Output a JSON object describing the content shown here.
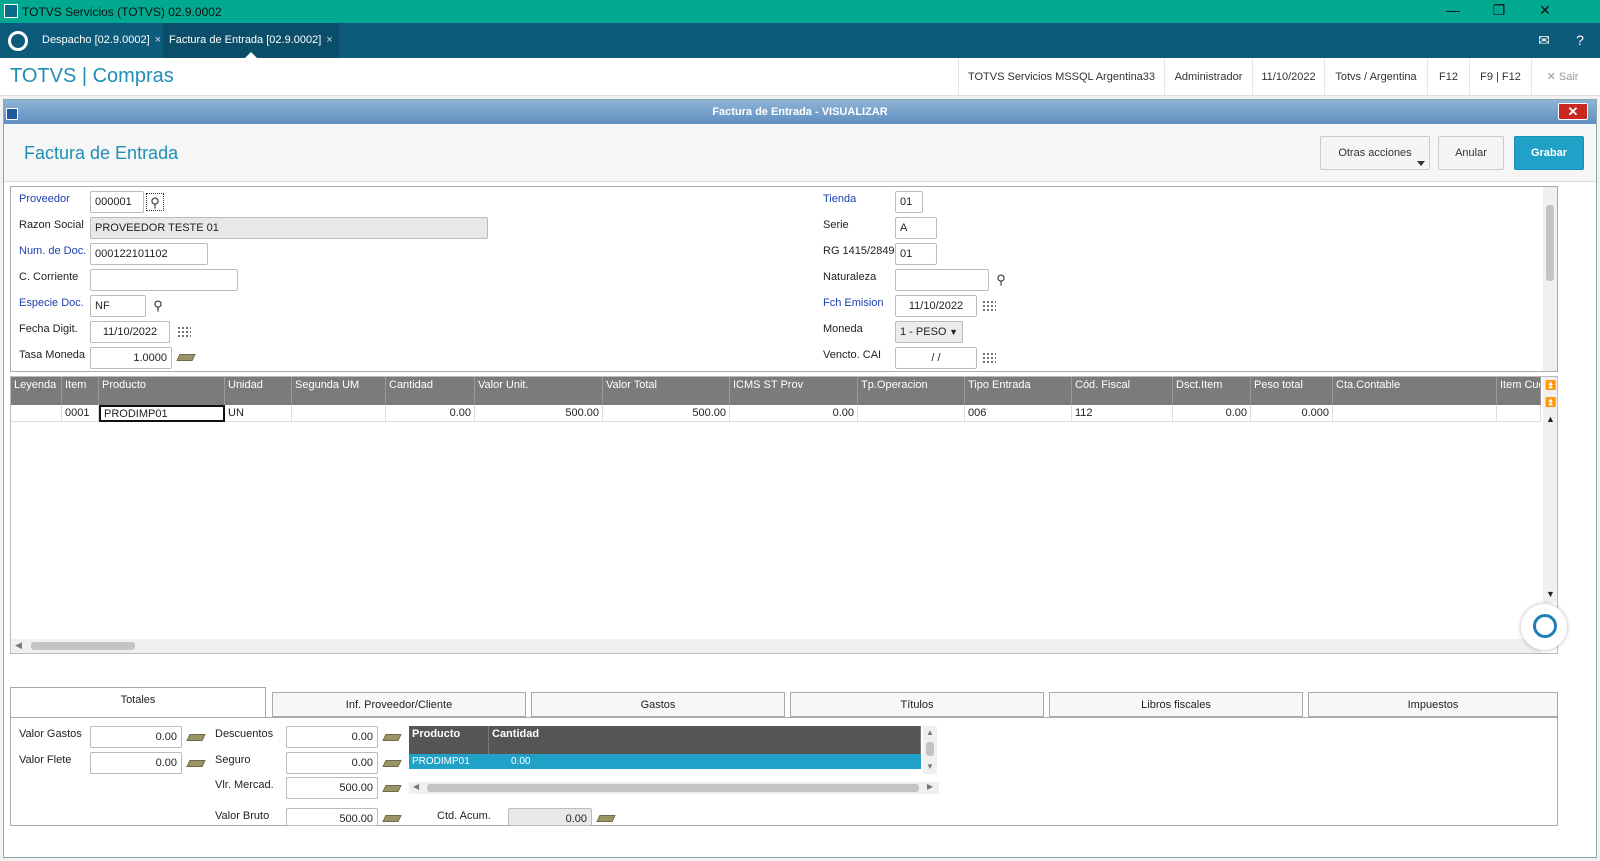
{
  "window": {
    "title": "TOTVS Servicios (TOTVS) 02.9.0002",
    "minimize": "—",
    "restore": "❐",
    "close": "✕"
  },
  "tabs": [
    {
      "label": "Despacho [02.9.0002]",
      "close": "×"
    },
    {
      "label": "Factura de Entrada [02.9.0002]",
      "close": "×"
    }
  ],
  "header": {
    "brand": "TOTVS | Compras",
    "env": "TOTVS Servicios MSSQL Argentina33",
    "user": "Administrador",
    "date": "11/10/2022",
    "company": "Totvs / Argentina",
    "f12": "F12",
    "f9f12": "F9 | F12",
    "exit": "Sair",
    "exit_icon": "✕"
  },
  "dialog": {
    "title": "Factura de Entrada - VISUALIZAR",
    "close": "✕",
    "form_title": "Factura de Entrada",
    "btn_other": "Otras acciones",
    "btn_cancel": "Anular",
    "btn_save": "Grabar"
  },
  "fields": {
    "proveedor": {
      "label": "Proveedor",
      "value": "000001"
    },
    "razon_social": {
      "label": "Razon Social",
      "value": "PROVEEDOR TESTE 01"
    },
    "num_doc": {
      "label": "Num. de Doc.",
      "value": "000122101102"
    },
    "c_corriente": {
      "label": "C. Corriente",
      "value": ""
    },
    "especie_doc": {
      "label": "Especie Doc.",
      "value": "NF"
    },
    "fecha_digit": {
      "label": "Fecha Digit.",
      "value": "11/10/2022"
    },
    "tasa_moneda": {
      "label": "Tasa Moneda",
      "value": "1.0000"
    },
    "tienda": {
      "label": "Tienda",
      "value": "01"
    },
    "serie": {
      "label": "Serie",
      "value": "A"
    },
    "rg": {
      "label": "RG 1415/2849",
      "value": "01"
    },
    "naturaleza": {
      "label": "Naturaleza",
      "value": ""
    },
    "fch_emision": {
      "label": "Fch Emision",
      "value": "11/10/2022"
    },
    "moneda": {
      "label": "Moneda",
      "value": "1 - PESO"
    },
    "vencto_cai": {
      "label": "Vencto. CAI",
      "value": "/ /"
    }
  },
  "grid": {
    "columns": [
      "Leyenda",
      "Item",
      "Producto",
      "Unidad",
      "Segunda UM",
      "Cantidad",
      "Valor Unit.",
      "Valor Total",
      "ICMS ST Prov",
      "Tp.Operacion",
      "Tipo Entrada",
      "Cód. Fiscal",
      "Dsct.Item",
      "Peso total",
      "Cta.Contable",
      "Item Cue"
    ],
    "rows": [
      [
        "",
        "0001",
        "PRODIMP01",
        "UN",
        "",
        "0.00",
        "500.00",
        "500.00",
        "0.00",
        "",
        "006",
        "112",
        "0.00",
        "0.000",
        "",
        ""
      ]
    ]
  },
  "bottom_tabs": [
    "Totales",
    "Inf. Proveedor/Cliente",
    "Gastos",
    "Títulos",
    "Libros fiscales",
    "Impuestos"
  ],
  "totales": {
    "valor_gastos": {
      "label": "Valor Gastos",
      "value": "0.00"
    },
    "valor_flete": {
      "label": "Valor Flete",
      "value": "0.00"
    },
    "descuentos": {
      "label": "Descuentos",
      "value": "0.00"
    },
    "seguro": {
      "label": "Seguro",
      "value": "0.00"
    },
    "vlr_mercad": {
      "label": "Vlr. Mercad.",
      "value": "500.00"
    },
    "valor_bruto": {
      "label": "Valor Bruto",
      "value": "500.00"
    },
    "ctd_acum": {
      "label": "Ctd. Acum.",
      "value": "0.00"
    },
    "mini_grid": {
      "columns": [
        "Producto",
        "Cantidad"
      ],
      "rows": [
        [
          "PRODIMP01",
          "0.00"
        ]
      ]
    }
  },
  "icons": {
    "search": "search-icon",
    "calendar": "calendar-icon",
    "calculator": "money-calculator-icon"
  },
  "colors": {
    "titlebar": "#00a98f",
    "tabbar": "#0d5b7a",
    "brand": "#1e8fb5",
    "primary_button": "#1fa1c8"
  }
}
